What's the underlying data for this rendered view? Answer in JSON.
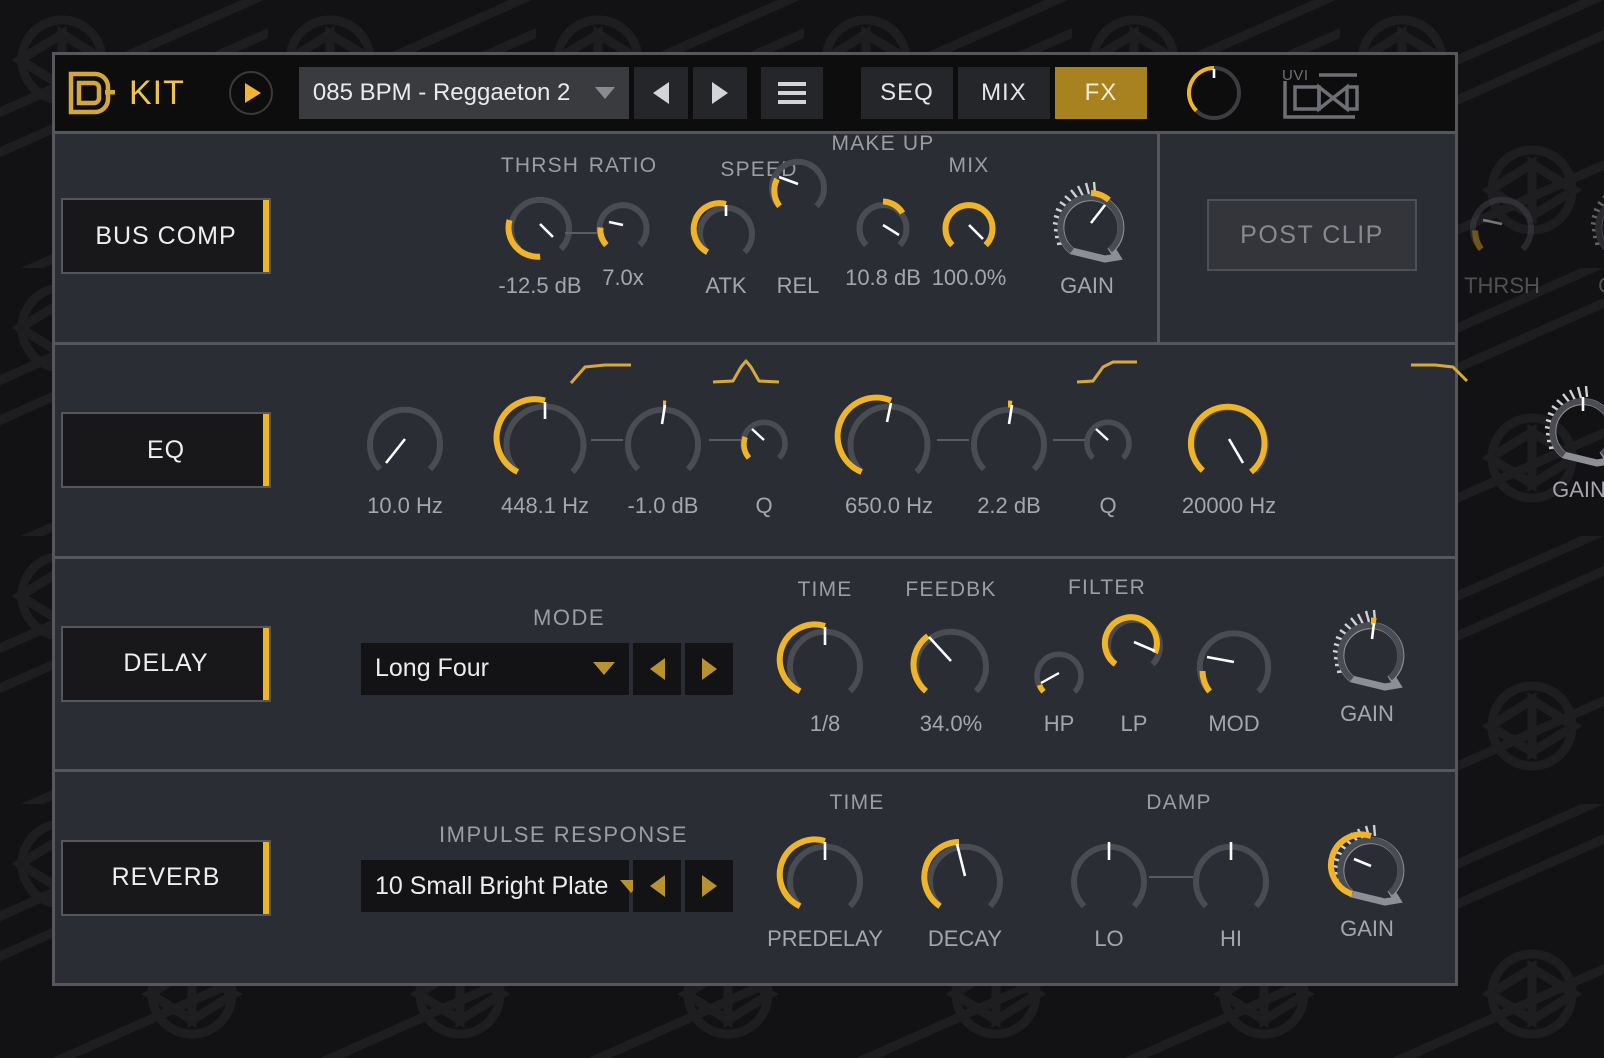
{
  "app": {
    "title": "KIT",
    "logo_icon": "uvi-falcon-d-logo",
    "brand_icon": "uvi-infinity-logo",
    "accent_gold": "#f0b429",
    "accent_dark_gold": "#a8821f",
    "panel_bg": "#2b2d34",
    "header_bg": "#0d0d0e"
  },
  "header": {
    "play_icon": "play-icon",
    "preset_name": "085 BPM - Reggaeton 2",
    "preset_caret_icon": "chevron-down-icon",
    "prev_icon": "triangle-left-icon",
    "next_icon": "triangle-right-icon",
    "menu_icon": "hamburger-menu-icon",
    "tabs": [
      {
        "label": "SEQ",
        "active": false
      },
      {
        "label": "MIX",
        "active": false
      },
      {
        "label": "FX",
        "active": true
      }
    ],
    "master_knob": {
      "name": "master-volume-knob",
      "value_pct": 78
    }
  },
  "sections": [
    {
      "id": "bus-comp",
      "label": "BUS COMP",
      "enabled": true,
      "toggle_icon": "triangle-right-icon",
      "knobs": [
        {
          "name": "threshold-knob",
          "top": "THRSH",
          "bottom": "-12.5 dB",
          "fill": 0.62,
          "indicator": 0.62,
          "size": 70
        },
        {
          "name": "ratio-knob",
          "top": "RATIO",
          "bottom": "7.0x",
          "fill": 0.3,
          "indicator": 0.46,
          "size": 56
        },
        {
          "name": "attack-knob",
          "top": "SPEED",
          "bottom": "ATK",
          "fill": 0.5,
          "indicator": 0.5,
          "size": 62
        },
        {
          "name": "release-knob",
          "top": "",
          "bottom": "REL",
          "fill": 0.3,
          "indicator": 0.33,
          "size": 62
        },
        {
          "name": "makeup-knob",
          "top": "MAKE UP",
          "bottom": "10.8 dB",
          "fill": 0.28,
          "indicator": 0.61,
          "size": 56
        },
        {
          "name": "mix-knob",
          "top": "MIX",
          "bottom": "100.0%",
          "fill": 1.0,
          "indicator": 1.0,
          "size": 56
        },
        {
          "name": "gain-knob",
          "top": "",
          "bottom": "GAIN",
          "fill": 0.6,
          "indicator": 0.6,
          "size": 66,
          "meter": true
        }
      ]
    },
    {
      "id": "post-clip",
      "label": "POST CLIP",
      "enabled": false,
      "knobs": [
        {
          "name": "postclip-threshold-knob",
          "top": "",
          "bottom": "THRSH",
          "fill": 0.12,
          "indicator": 0.14,
          "size": 70
        },
        {
          "name": "postclip-gain-knob",
          "top": "",
          "bottom": "GAIN",
          "fill": 0.5,
          "indicator": 0.5,
          "size": 66,
          "meter": true
        }
      ]
    },
    {
      "id": "eq",
      "label": "EQ",
      "enabled": true,
      "toggle_icon": "triangle-right-icon",
      "knobs": [
        {
          "name": "eq-lowcut-freq-knob",
          "top": "",
          "bottom": "10.0 Hz",
          "fill": 0.0,
          "indicator": 0.07,
          "size": 84,
          "icon": "highpass-curve-icon"
        },
        {
          "name": "eq-bell-freq-knob",
          "top": "",
          "bottom": "448.1 Hz",
          "fill": 0.51,
          "indicator": 0.51,
          "size": 92,
          "icon": "bell-curve-icon"
        },
        {
          "name": "eq-bell-gain-knob",
          "top": "",
          "bottom": "-1.0 dB",
          "fill": 0.02,
          "indicator": 0.52,
          "size": 84
        },
        {
          "name": "eq-bell-q-knob",
          "top": "",
          "bottom": "Q",
          "fill": 0.12,
          "indicator": 0.16,
          "size": 50
        },
        {
          "name": "eq-shelf-freq-knob",
          "top": "",
          "bottom": "650.0 Hz",
          "fill": 0.52,
          "indicator": 0.54,
          "size": 92,
          "icon": "highshelf-curve-icon"
        },
        {
          "name": "eq-shelf-gain-knob",
          "top": "",
          "bottom": "2.2 dB",
          "fill": 0.02,
          "indicator": 0.54,
          "size": 84
        },
        {
          "name": "eq-shelf-q-knob",
          "top": "",
          "bottom": "Q",
          "fill": 0.0,
          "indicator": 0.16,
          "size": 50
        },
        {
          "name": "eq-lowpass-freq-knob",
          "top": "",
          "bottom": "20000 Hz",
          "fill": 0.92,
          "indicator": 0.92,
          "size": 88,
          "icon": "lowpass-curve-icon"
        },
        {
          "name": "eq-gain-knob",
          "top": "",
          "bottom": "GAIN",
          "fill": 0.5,
          "indicator": 0.5,
          "size": 66,
          "meter": true
        }
      ]
    },
    {
      "id": "delay",
      "label": "DELAY",
      "enabled": true,
      "toggle_icon": "triangle-right-icon",
      "combo": {
        "label": "MODE",
        "name": "delay-mode-select",
        "value": "Long Four",
        "caret_icon": "chevron-down-icon",
        "prev_icon": "triangle-left-icon",
        "next_icon": "triangle-right-icon"
      },
      "knobs": [
        {
          "name": "delay-time-knob",
          "top": "TIME",
          "bottom": "1/8",
          "fill": 0.5,
          "indicator": 0.5,
          "size": 84
        },
        {
          "name": "delay-feedback-knob",
          "top": "FEEDBK",
          "bottom": "34.0%",
          "fill": 0.36,
          "indicator": 0.36,
          "size": 84
        },
        {
          "name": "delay-hp-knob",
          "top": "FILTER",
          "bottom": "HP",
          "fill": 0.04,
          "indicator": 0.07,
          "size": 52
        },
        {
          "name": "delay-lp-knob",
          "top": "",
          "bottom": "LP",
          "fill": 0.66,
          "indicator": 0.66,
          "size": 62
        },
        {
          "name": "delay-mod-knob",
          "top": "",
          "bottom": "MOD",
          "fill": 0.14,
          "indicator": 0.22,
          "size": 82
        },
        {
          "name": "delay-gain-knob",
          "top": "",
          "bottom": "GAIN",
          "fill": 0.54,
          "indicator": 0.54,
          "size": 66,
          "meter": true
        }
      ]
    },
    {
      "id": "reverb",
      "label": "REVERB",
      "enabled": true,
      "toggle_icon": "triangle-right-icon",
      "combo": {
        "label": "IMPULSE RESPONSE",
        "name": "reverb-impulse-response-select",
        "value": "10 Small Bright Plate",
        "caret_icon": "chevron-down-icon",
        "prev_icon": "triangle-left-icon",
        "next_icon": "triangle-right-icon"
      },
      "knobs": [
        {
          "name": "reverb-predelay-knob",
          "top": "TIME",
          "bottom": "PREDELAY",
          "fill": 0.5,
          "indicator": 0.5,
          "size": 84
        },
        {
          "name": "reverb-decay-knob",
          "top": "",
          "bottom": "DECAY",
          "fill": 0.46,
          "indicator": 0.46,
          "size": 84
        },
        {
          "name": "reverb-damp-lo-knob",
          "top": "DAMP",
          "bottom": "LO",
          "fill": 0.0,
          "indicator": 0.5,
          "size": 84
        },
        {
          "name": "reverb-damp-hi-knob",
          "top": "",
          "bottom": "HI",
          "fill": 0.0,
          "indicator": 0.5,
          "size": 84
        },
        {
          "name": "reverb-gain-knob",
          "top": "",
          "bottom": "GAIN",
          "fill": 0.44,
          "indicator": 0.44,
          "size": 66,
          "meter": true
        }
      ]
    }
  ]
}
